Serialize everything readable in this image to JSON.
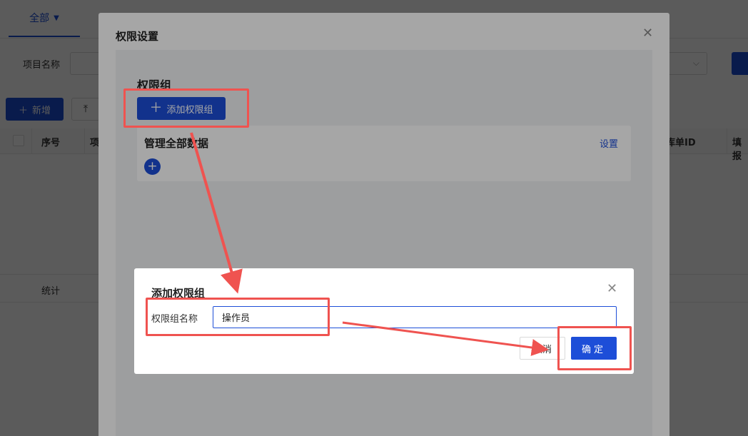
{
  "background": {
    "tab_label": "全部",
    "filter_label": "项目名称",
    "add_button_label": "新增",
    "columns": [
      "序号",
      "项",
      "入库单ID",
      "填报"
    ],
    "total_label": "统计"
  },
  "outer_dialog": {
    "title": "权限设置",
    "section_heading": "权限组",
    "add_group_button": "添加权限组",
    "group_card": {
      "title": "管理全部数据",
      "settings_link": "设置"
    }
  },
  "inner_dialog": {
    "title": "添加权限组",
    "field_label": "权限组名称",
    "field_value": "操作员",
    "cancel_label": "取消",
    "ok_label": "确定"
  },
  "colors": {
    "primary": "#1d4ed8",
    "annotation": "#ef5350"
  },
  "icons": {
    "close": "close-icon",
    "plus": "plus-icon",
    "caret": "caret-down-icon",
    "upload": "upload-icon",
    "chevron": "chevron-down-icon"
  }
}
